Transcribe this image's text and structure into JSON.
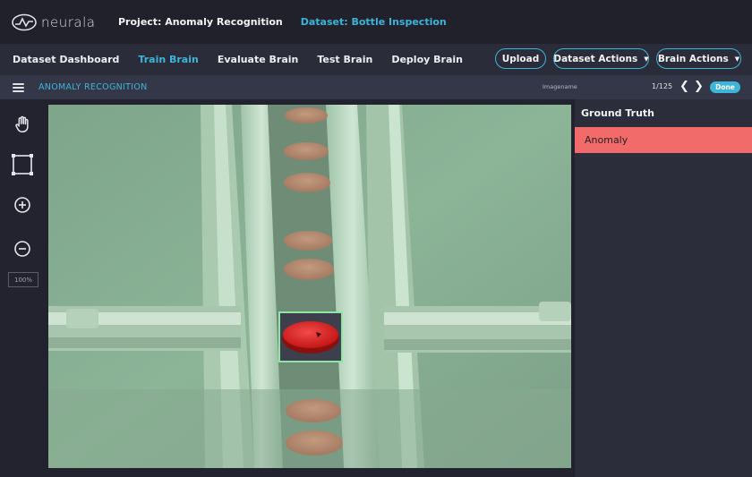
{
  "header": {
    "logo_text": "neurala",
    "project": "Project: Anomaly Recognition",
    "dataset": "Dataset: Bottle Inspection"
  },
  "nav": {
    "items": [
      {
        "label": "Dataset Dashboard",
        "active": false
      },
      {
        "label": "Train Brain",
        "active": true
      },
      {
        "label": "Evaluate Brain",
        "active": false
      },
      {
        "label": "Test Brain",
        "active": false
      },
      {
        "label": "Deploy Brain",
        "active": false
      }
    ],
    "buttons": {
      "upload": "Upload",
      "dataset_actions": "Dataset Actions",
      "brain_actions": "Brain Actions"
    }
  },
  "subbar": {
    "title": "ANOMALY RECOGNITION",
    "image_name": "Imagename",
    "counter": "1/125",
    "done": "Done"
  },
  "toolbar": {
    "tools": [
      "hand-icon",
      "rectangle-select-icon",
      "zoom-in-icon",
      "zoom-out-icon"
    ],
    "zoom": "100%"
  },
  "panel": {
    "title": "Ground Truth",
    "labels": [
      {
        "name": "Anomaly",
        "color": "#f26b6b"
      }
    ]
  },
  "colors": {
    "accent": "#3fb4d9",
    "anomaly": "#f26b6b",
    "bounding_box": "#8fe6a4"
  }
}
